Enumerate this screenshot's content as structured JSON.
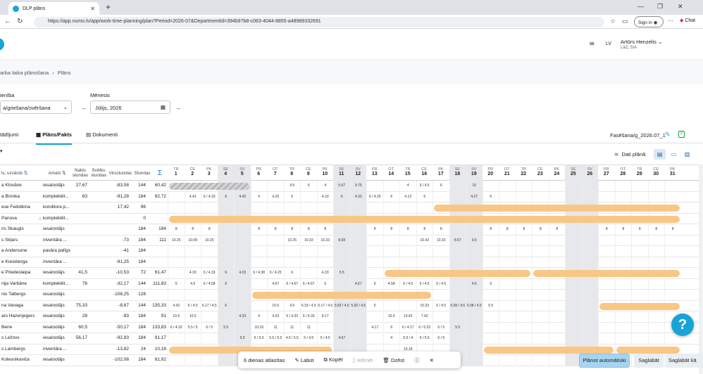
{
  "browser": {
    "tab_title": "DLP plāns",
    "url": "https://app.numo.lv/app/work-time-planning/plan?Period=2026-07&DepartmentId=394b97b8-c063-4044-8855-a48989332691",
    "sign_in": "Sign in",
    "chat": "Chat"
  },
  "header": {
    "lang": "LV",
    "user_name": "Artūrs Henzelis",
    "company": "L&C SIA"
  },
  "breadcrumb": [
    "arba laika plānošana",
    "Plāns"
  ],
  "filters": {
    "dept_label": "ienība",
    "dept_value": "a/griešana/svēršana",
    "month_label": "Mēnesis",
    "month_value": "Jūlijs, 2026"
  },
  "tabs": [
    "tādījumi",
    "Plāns/Fakts",
    "Dokumenti"
  ],
  "phase_name": "Fasēšana/g_2026.07_1",
  "dati_plana": "Dati plānā",
  "columns": {
    "name": "ls, uzvārds",
    "role": "Amats",
    "night": "Nakts stundas",
    "holiday": "Svētku stundas",
    "overtime": "Virsstundas",
    "hours": "Stundas",
    "sum": "Σ"
  },
  "days": [
    {
      "dw": "TR",
      "n": "1"
    },
    {
      "dw": "CE",
      "n": "2"
    },
    {
      "dw": "PK",
      "n": "3"
    },
    {
      "dw": "SE",
      "n": "4",
      "we": true
    },
    {
      "dw": "SV",
      "n": "5",
      "we": true
    },
    {
      "dw": "PR",
      "n": "6"
    },
    {
      "dw": "OT",
      "n": "7"
    },
    {
      "dw": "TR",
      "n": "8"
    },
    {
      "dw": "CE",
      "n": "9"
    },
    {
      "dw": "PK",
      "n": "10"
    },
    {
      "dw": "SE",
      "n": "11",
      "we": true
    },
    {
      "dw": "SV",
      "n": "12",
      "we": true
    },
    {
      "dw": "PR",
      "n": "13"
    },
    {
      "dw": "OT",
      "n": "14"
    },
    {
      "dw": "TR",
      "n": "15"
    },
    {
      "dw": "CE",
      "n": "16"
    },
    {
      "dw": "PK",
      "n": "17"
    },
    {
      "dw": "SE",
      "n": "18",
      "we": true
    },
    {
      "dw": "SV",
      "n": "19",
      "we": true
    },
    {
      "dw": "PR",
      "n": "20"
    },
    {
      "dw": "OT",
      "n": "21"
    },
    {
      "dw": "TR",
      "n": "22"
    },
    {
      "dw": "CE",
      "n": "23"
    },
    {
      "dw": "PK",
      "n": "24"
    },
    {
      "dw": "SE",
      "n": "25",
      "we": true
    },
    {
      "dw": "SV",
      "n": "26",
      "we": true
    },
    {
      "dw": "PR",
      "n": "27"
    },
    {
      "dw": "OT",
      "n": "28"
    },
    {
      "dw": "TR",
      "n": "29"
    },
    {
      "dw": "CE",
      "n": "30"
    },
    {
      "dw": "PK",
      "n": "31"
    }
  ],
  "employees": [
    {
      "name": "a Klovāne",
      "role": "iesaiņotājs",
      "night": "27,67",
      "holiday": "",
      "ot": "-83,58",
      "hours": "144",
      "sum": "60,42",
      "cells": {
        "8": "4.5",
        "9": "6",
        "10": "4",
        "11": "5.67",
        "12": "9.75",
        "15": "4",
        "16": "6 / 4.5",
        "17": "6",
        "19": "10"
      },
      "hatch": [
        1,
        5
      ]
    },
    {
      "name": "a Bronka",
      "role": "komplektēt...",
      "night": "63",
      "holiday": "",
      "ot": "-91,28",
      "hours": "184",
      "sum": "92,72",
      "cells": {
        "2": "4.42",
        "3": "6 / 4.33",
        "4": "6",
        "5": "4.42",
        "6": "6",
        "7": "4.25",
        "8": "6",
        "10": "4.33",
        "11": "6",
        "12": "4.33",
        "13": "6 / 4.25",
        "14": "6",
        "15": "4.12",
        "16": "6",
        "19": "4.27",
        "20": "6"
      }
    },
    {
      "name": "ese Fedotkina",
      "role": "konditora p...",
      "night": "",
      "holiday": "",
      "ot": "17,42",
      "hours": "96",
      "sum": "",
      "bars": [
        [
          17,
          31
        ]
      ]
    },
    {
      "name": " Panova",
      "role": "komplektēt...",
      "warn": true,
      "night": "",
      "holiday": "",
      "ot": "",
      "hours": "0",
      "sum": "",
      "bars": [
        [
          1,
          31
        ]
      ]
    },
    {
      "name": "ris Skaugis",
      "role": "iesaiņotājs",
      "night": "",
      "holiday": "",
      "ot": "",
      "hours": "184",
      "sum": "184",
      "cells": {
        "1": "8",
        "2": "8",
        "3": "8",
        "6": "8",
        "7": "8",
        "8": "8",
        "9": "8",
        "10": "8",
        "13": "8",
        "14": "8",
        "15": "8",
        "16": "8",
        "17": "8",
        "20": "8",
        "21": "8",
        "22": "8",
        "23": "8",
        "24": "8",
        "27": "8",
        "28": "8",
        "29": "8",
        "30": "8",
        "31": "8"
      }
    },
    {
      "name": "s Skļars",
      "role": "inventāra ...",
      "night": "",
      "holiday": "",
      "ot": "-73",
      "hours": "184",
      "sum": "111",
      "cells": {
        "1": "10.25",
        "2": "10.08",
        "3": "10.25",
        "8": "10.25",
        "9": "10.33",
        "10": "10.33",
        "11": "8.58",
        "16": "10.42",
        "17": "10.33",
        "18": "8.67",
        "19": "9.5"
      }
    },
    {
      "name": "a Andersone",
      "role": "pavāra palīgs",
      "night": "",
      "holiday": "",
      "ot": "-41",
      "hours": "184",
      "sum": ""
    },
    {
      "name": "e Kreisberga",
      "role": "inventāra ...",
      "night": "",
      "holiday": "",
      "ot": "-91,25",
      "hours": "184",
      "sum": ""
    },
    {
      "name": "e Priedeslaipa",
      "role": "iesaiņotājs",
      "night": "41,5",
      "holiday": "",
      "ot": "-10,53",
      "hours": "72",
      "sum": "61,47",
      "cells": {
        "2": "4.33",
        "3": "6 / 4.33",
        "4": "6",
        "5": "4.33",
        "6": "6 / 4.38",
        "7": "6 / 4.25",
        "8": "6",
        "10": "4.33",
        "11": "5.5"
      },
      "bars": [
        [
          14,
          22
        ],
        [
          23,
          31
        ]
      ]
    },
    {
      "name": "nija Varbāne",
      "role": "komplektēt...",
      "night": "76",
      "holiday": "",
      "ot": "-32,17",
      "hours": "144",
      "sum": "111,83",
      "cells": {
        "1": "6",
        "2": "4.5",
        "3": "6 / 4.58",
        "4": "6",
        "7": "4.67",
        "8": "6 / 4.67",
        "9": "6 / 4.67",
        "10": "6",
        "12": "4.67",
        "13": "6",
        "14": "4.58",
        "15": "6 / 4.5",
        "16": "6 / 4.5",
        "17": "6 / 4.5",
        "19": "4.5",
        "20": "6"
      }
    },
    {
      "name": "nis Talbergs",
      "role": "iesaiņotājs",
      "night": "",
      "holiday": "",
      "ot": "-108,25",
      "hours": "128",
      "sum": "",
      "bars": [
        [
          6,
          16
        ]
      ]
    },
    {
      "name": "na Vanaga",
      "role": "iesaiņotājs",
      "night": "75,33",
      "holiday": "",
      "ot": "-8,67",
      "hours": "144",
      "sum": "135,33",
      "cells": {
        "1": "4.42",
        "2": "6 / 4.5",
        "3": "6.17 / 4.5",
        "4": "6",
        "7": "10.5",
        "8": "4.5",
        "9": "6.33 / 4.5",
        "10": "6.17 / 4.5",
        "11": "5.83 / 4.5",
        "12": "5.92 / 4.5",
        "13": "6",
        "16": "10.33",
        "17": "6 / 4.5",
        "18": "6.08 / 4.5",
        "19": "5.08 / 4.5",
        "20": "5.5"
      },
      "bars": [
        [
          27,
          31
        ]
      ]
    },
    {
      "name": "ars Hazenjegers",
      "role": "iesaiņotājs",
      "night": "28",
      "holiday": "",
      "ot": "-93",
      "hours": "184",
      "sum": "91",
      "cells": {
        "1": "10.5",
        "2": "10.5",
        "5": "4.33",
        "6": "6",
        "7": "4.33",
        "8": "6 / 4.33",
        "9": "6 / 4.33",
        "10": "8.17",
        "14": "10.5",
        "15": "10.42",
        "16": "7.42"
      }
    },
    {
      "name": " Bene",
      "role": "iesaiņotājs",
      "night": "60,5",
      "holiday": "",
      "ot": "-50,17",
      "hours": "184",
      "sum": "133,83",
      "cells": {
        "1": "6 / 4.33",
        "2": "5.5 / 5",
        "3": "6 / 5",
        "4": "5.5",
        "6": "10.33",
        "7": "11",
        "8": "11",
        "9": "11",
        "13": "4.17",
        "14": "6",
        "15": "6 / 4.17",
        "16": "6 / 5.33",
        "17": "6 / 5",
        "18": "5.5"
      }
    },
    {
      "name": "s Ležovs",
      "role": "iesaiņotājs",
      "night": "56,17",
      "holiday": "",
      "ot": "-92,83",
      "hours": "184",
      "sum": "91,17",
      "cells": {
        "5": "5.5",
        "6": "6 / 5.5",
        "7": "5.5 / 5.5",
        "8": "4.5 / 5.5",
        "9": "5 / 4.5",
        "10": "5 / 4.5",
        "11": "4.67",
        "14": "4",
        "15": "5.5 / 4",
        "16": "6 / 5.5",
        "17": "6 / 5"
      }
    },
    {
      "name": "s Lambergs",
      "role": "inventāra ...",
      "night": "",
      "holiday": "",
      "ot": "-13,82",
      "hours": "24",
      "sum": "10,18",
      "cells": {
        "15": "10.18"
      },
      "bars": [
        [
          1,
          10
        ],
        [
          20,
          27
        ],
        [
          28,
          31
        ]
      ]
    },
    {
      "name": " Kolesnikoviča",
      "role": "iesaiņotājs",
      "night": "",
      "holiday": "",
      "ot": "-102,08",
      "hours": "184",
      "sum": "81,92"
    }
  ],
  "toolbar": {
    "selected": "6 dienas atlasītas",
    "edit": "Labot",
    "copy": "Kopēt",
    "paste": "Ielīmēt",
    "delete": "Dzēst"
  },
  "buttons": {
    "auto": "Plānot automātiski",
    "save": "Saglabāt",
    "save2": "Saglabāt kā"
  },
  "help": "?"
}
